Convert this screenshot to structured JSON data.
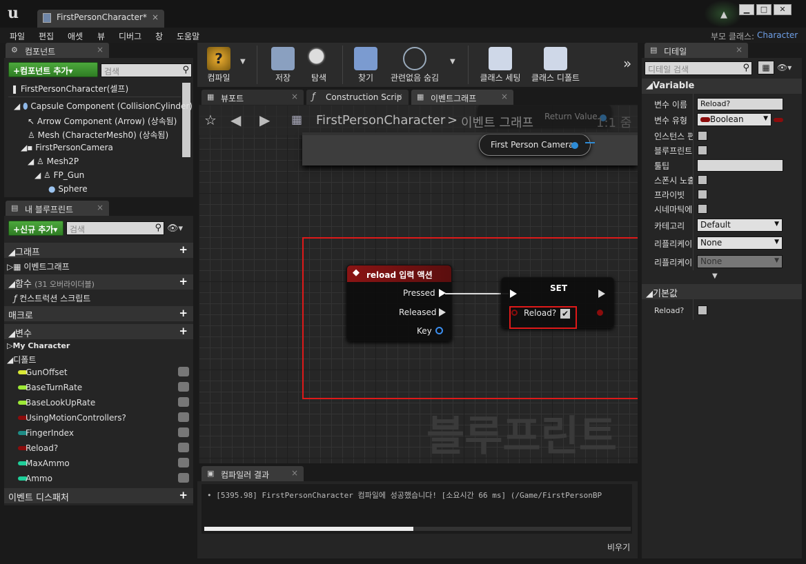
{
  "window": {
    "tab_title": "FirstPersonCharacter*",
    "parent_class_label": "부모 클래스:",
    "parent_class_value": "Character"
  },
  "menu": [
    "파일",
    "편집",
    "애셋",
    "뷰",
    "디버그",
    "창",
    "도움말"
  ],
  "components": {
    "tab": "컴포넌트",
    "add_button": "+컴포넌트 추가▾",
    "search_placeholder": "검색",
    "tree": [
      "FirstPersonCharacter(셀프)",
      "Capsule Component (CollisionCylinder)",
      "Arrow Component (Arrow) (상속됨)",
      "Mesh (CharacterMesh0) (상속됨)",
      "FirstPersonCamera",
      "Mesh2P",
      "FP_Gun",
      "Sphere"
    ]
  },
  "my_blueprint": {
    "tab": "내 블루프린트",
    "add_button": "+신규 추가▾",
    "search_placeholder": "검색",
    "graph_section": "그래프",
    "event_graph": "이벤트그래프",
    "functions_section": "함수",
    "functions_count": "(31 오버라이더블)",
    "construction_script": "컨스트럭션 스크립트",
    "macros_section": "매크로",
    "variables_section": "변수",
    "my_character": "My Character",
    "default_category": "디폴트",
    "variables": [
      {
        "name": "GunOffset",
        "color": "#d9e835"
      },
      {
        "name": "BaseTurnRate",
        "color": "#9de836"
      },
      {
        "name": "BaseLookUpRate",
        "color": "#9de836"
      },
      {
        "name": "UsingMotionControllers?",
        "color": "#8b0c0c"
      },
      {
        "name": "FingerIndex",
        "color": "#1e8c86"
      },
      {
        "name": "Reload?",
        "color": "#8b0c0c"
      },
      {
        "name": "MaxAmmo",
        "color": "#1fcf9a"
      },
      {
        "name": "Ammo",
        "color": "#1fcf9a"
      }
    ],
    "dispatchers_section": "이벤트 디스패처"
  },
  "toolbar": {
    "compile": "컴파일",
    "save": "저장",
    "browse": "탐색",
    "find": "찾기",
    "hide_unrelated": "관련없음 숨김",
    "class_settings": "클래스 세팅",
    "class_defaults": "클래스 디폴트"
  },
  "editor_tabs": {
    "viewport": "뷰포트",
    "construction": "Construction Scrip",
    "event_graph": "이벤트그래프"
  },
  "graph": {
    "breadcrumb_root": "FirstPersonCharacter",
    "breadcrumb_sep": ">",
    "breadcrumb_current": "이벤트 그래프",
    "zoom": "1:1 줌",
    "watermark": "블루프린트",
    "return_value": "Return Value",
    "camera_node": "First Person Camera",
    "input_node": {
      "title": "reload 입력 액션",
      "pins": [
        "Pressed",
        "Released",
        "Key"
      ]
    },
    "set_node": {
      "title": "SET",
      "var_label": "Reload?"
    }
  },
  "compiler": {
    "tab": "컴파일러 결과",
    "message": "[5395.98] FirstPersonCharacter 컴파일에 성공했습니다! [소요시간 66 ms] (/Game/FirstPersonBP",
    "clear": "비우기",
    "progress": 0.49
  },
  "details": {
    "tab": "디테일",
    "search_placeholder": "디테일 검색",
    "variable_section": "Variable",
    "rows": {
      "var_name": "변수 이름",
      "var_type": "변수 유형",
      "instance": "인스턴스 편집",
      "blueprint_ro": "블루프린트 읽기",
      "tooltip": "툴팁",
      "spawn": "스폰시 노출",
      "private": "프라이빗",
      "cinematic": "시네마틱에 노출",
      "category": "카테고리",
      "rep": "리플리케이션",
      "rep_cond": "리플리케이션 조건"
    },
    "var_name_value": "Reload?",
    "var_type_value": "Boolean",
    "category_value": "Default",
    "rep_value": "None",
    "rep_cond_value": "None",
    "default_section": "기본값",
    "default_var": "Reload?"
  }
}
